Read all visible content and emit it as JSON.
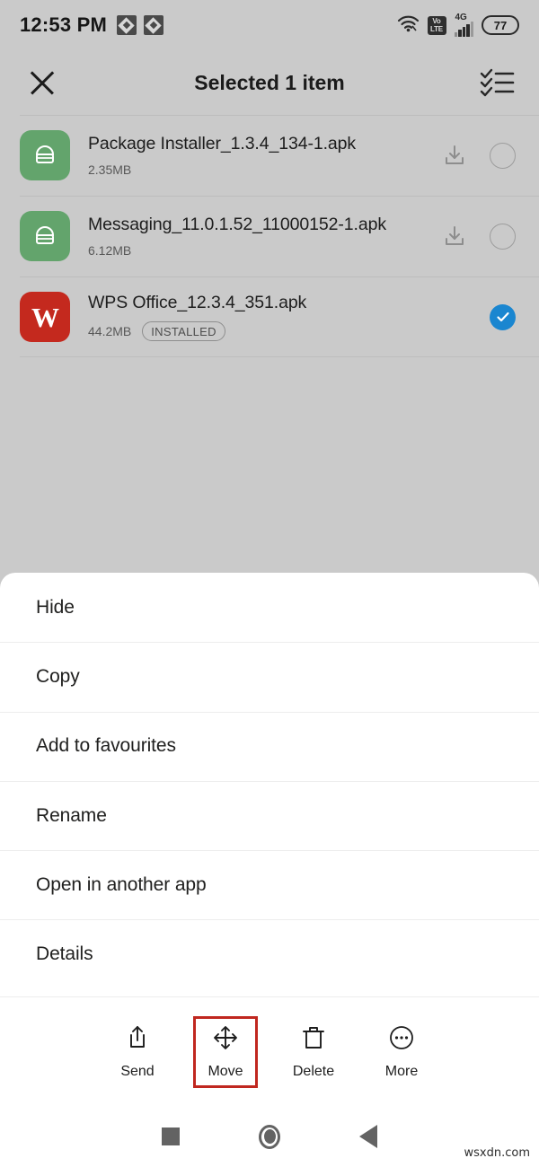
{
  "status_bar": {
    "time": "12:53 PM",
    "notification_icons": [
      "app-notification-icon",
      "app-notification-icon"
    ],
    "wifi_icon": "wifi-icon",
    "volte_line1": "Vo",
    "volte_line2": "LTE",
    "network_type": "4G",
    "battery_level": "77"
  },
  "app_bar": {
    "close_label": "close-icon",
    "title": "Selected 1 item",
    "select_all_label": "select-all-icon"
  },
  "files": [
    {
      "name": "Package Installer_1.3.4_134-1.apk",
      "size": "2.35MB",
      "badge": "",
      "icon_type": "apk",
      "selected": false,
      "has_download": true
    },
    {
      "name": "Messaging_11.0.1.52_11000152-1.apk",
      "size": "6.12MB",
      "badge": "",
      "icon_type": "apk",
      "selected": false,
      "has_download": true
    },
    {
      "name": "WPS Office_12.3.4_351.apk",
      "size": "44.2MB",
      "badge": "INSTALLED",
      "icon_type": "wps",
      "icon_letter": "W",
      "selected": true,
      "has_download": false
    }
  ],
  "sheet": {
    "items": [
      {
        "label": "Hide"
      },
      {
        "label": "Copy"
      },
      {
        "label": "Add to favourites"
      },
      {
        "label": "Rename"
      },
      {
        "label": "Open in another app"
      },
      {
        "label": "Details"
      }
    ]
  },
  "action_bar": {
    "actions": [
      {
        "label": "Send",
        "icon": "share-icon",
        "highlighted": false
      },
      {
        "label": "Move",
        "icon": "move-icon",
        "highlighted": true
      },
      {
        "label": "Delete",
        "icon": "trash-icon",
        "highlighted": false
      },
      {
        "label": "More",
        "icon": "more-icon",
        "highlighted": false
      }
    ],
    "highlight_color": "#c0271f"
  },
  "nav_bar": {
    "recents_label": "recents-icon",
    "home_label": "home-icon",
    "back_label": "back-icon"
  },
  "watermark": "wsxdn.com",
  "colors": {
    "background": "#cacaca",
    "sheet": "#ffffff",
    "accent_blue": "#1a86d0",
    "apk_green": "#63a46c",
    "wps_red": "#c4291e"
  }
}
